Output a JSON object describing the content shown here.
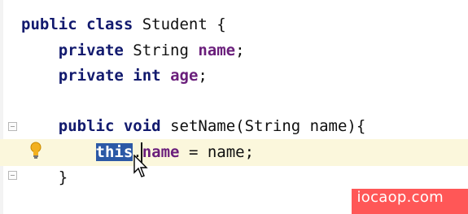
{
  "editor": {
    "lines": [
      {
        "segments": [
          {
            "t": "public",
            "c": "kw"
          },
          {
            "t": " "
          },
          {
            "t": "class",
            "c": "kw"
          },
          {
            "t": " Student {"
          }
        ]
      },
      {
        "segments": [
          {
            "t": "    "
          },
          {
            "t": "private",
            "c": "kw"
          },
          {
            "t": " String "
          },
          {
            "t": "name",
            "c": "field"
          },
          {
            "t": ";"
          }
        ]
      },
      {
        "segments": [
          {
            "t": "    "
          },
          {
            "t": "private",
            "c": "kw"
          },
          {
            "t": " "
          },
          {
            "t": "int",
            "c": "kw"
          },
          {
            "t": " "
          },
          {
            "t": "age",
            "c": "field"
          },
          {
            "t": ";"
          }
        ]
      },
      {
        "segments": [
          {
            "t": ""
          }
        ]
      },
      {
        "segments": [
          {
            "t": "    "
          },
          {
            "t": "public",
            "c": "kw"
          },
          {
            "t": " "
          },
          {
            "t": "void",
            "c": "kw"
          },
          {
            "t": " setName(String name){"
          }
        ]
      },
      {
        "segments": [
          {
            "t": "        "
          },
          {
            "t": "this",
            "c": "kw sel"
          },
          {
            "t": "."
          },
          {
            "t": "name",
            "c": "field"
          },
          {
            "t": " = name;"
          }
        ]
      },
      {
        "segments": [
          {
            "t": "    }"
          }
        ]
      }
    ]
  },
  "watermark": {
    "text": "iocaop.com"
  },
  "icons": {
    "intention": "lightbulb-icon",
    "fold": "fold-icon",
    "cursor": "mouse-pointer-icon"
  }
}
